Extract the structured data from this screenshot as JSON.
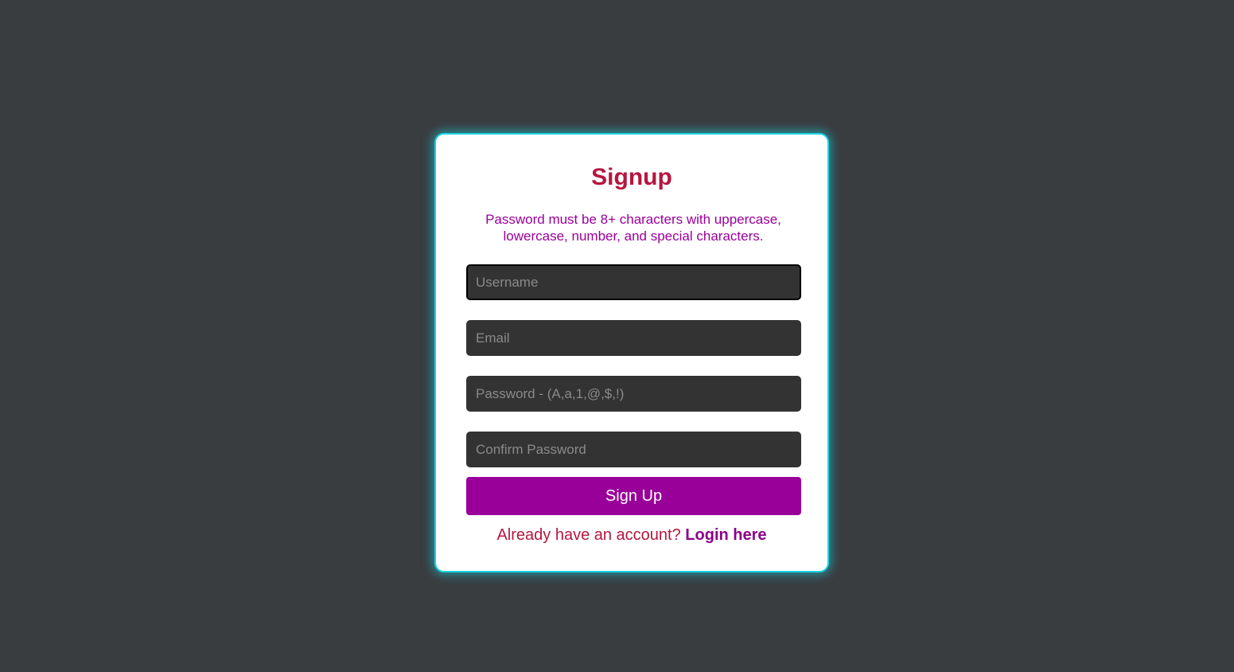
{
  "page": {
    "background_color": "#393d40"
  },
  "form": {
    "title": "Signup",
    "hint": "Password must be 8+ characters with uppercase, lowercase, number, and special characters.",
    "fields": {
      "username": {
        "placeholder": "Username",
        "value": ""
      },
      "email": {
        "placeholder": "Email",
        "value": ""
      },
      "password": {
        "placeholder": "Password - (A,a,1,@,$,!)",
        "value": ""
      },
      "confirm_password": {
        "placeholder": "Confirm Password",
        "value": ""
      }
    },
    "submit_label": "Sign Up",
    "footer": {
      "prompt": "Already have an account?",
      "link_label": "Login here"
    }
  },
  "colors": {
    "card_border": "#19d3e0",
    "title": "#b5163f",
    "hint": "#990099",
    "field_bg": "#333333",
    "button_bg": "#990099",
    "link": "#8b008b"
  }
}
